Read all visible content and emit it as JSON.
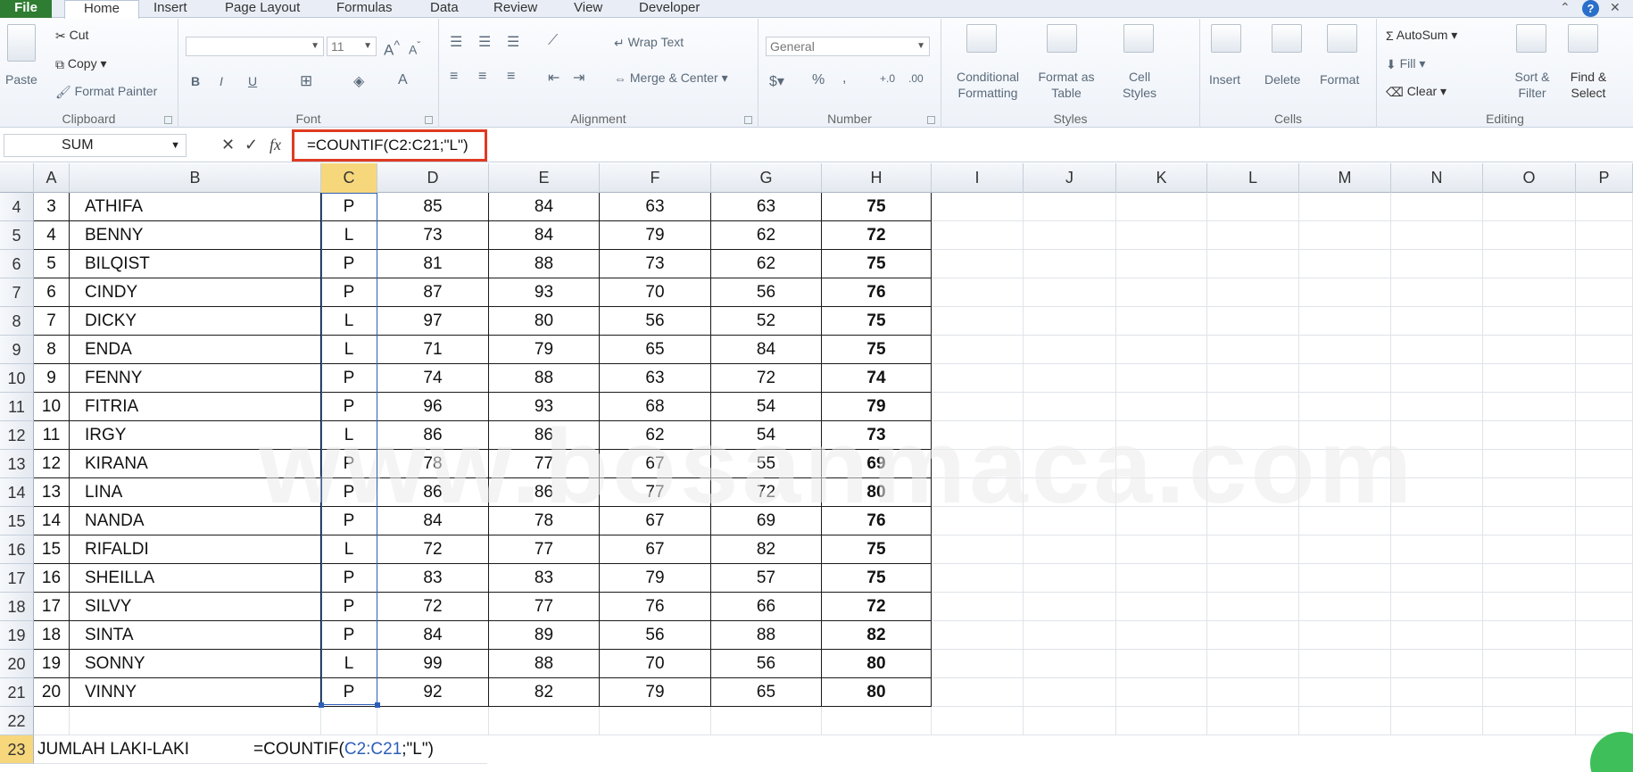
{
  "ribbon_tabs": [
    "File",
    "Home",
    "Insert",
    "Page Layout",
    "Formulas",
    "Data",
    "Review",
    "View",
    "Developer"
  ],
  "clipboard": {
    "paste": "Paste",
    "cut": "Cut",
    "copy": "Copy",
    "format_painter": "Format Painter",
    "label": "Clipboard"
  },
  "font": {
    "name": "",
    "size": "11",
    "label": "Font",
    "bold": "B",
    "italic": "I",
    "underline": "U"
  },
  "alignment": {
    "wrap_text": "Wrap Text",
    "merge_center": "Merge & Center",
    "label": "Alignment"
  },
  "number": {
    "format": "General",
    "percent": "%",
    "comma": ",",
    "label": "Number"
  },
  "styles": {
    "conditional": "Conditional Formatting",
    "format_table": "Format as Table",
    "cell_styles": "Cell Styles",
    "label": "Styles"
  },
  "cells": {
    "insert": "Insert",
    "delete": "Delete",
    "format": "Format",
    "label": "Cells"
  },
  "editing": {
    "autosum": "AutoSum",
    "fill": "Fill",
    "clear": "Clear",
    "sort": "Sort & Filter",
    "find": "Find & Select",
    "label": "Editing"
  },
  "formula_bar": {
    "name_box": "SUM",
    "cancel": "✕",
    "enter": "✓",
    "fx": "fx",
    "formula": "=COUNTIF(C2:C21;\"L\")"
  },
  "columns": [
    "A",
    "B",
    "C",
    "D",
    "E",
    "F",
    "G",
    "H",
    "I",
    "J",
    "K",
    "L",
    "M",
    "N",
    "O",
    "P"
  ],
  "rows": [
    {
      "r": "4",
      "no": "3",
      "name": "ATHIFA",
      "g": "P",
      "d": "85",
      "e": "84",
      "f": "63",
      "gv": "63",
      "h": "75"
    },
    {
      "r": "5",
      "no": "4",
      "name": "BENNY",
      "g": "L",
      "d": "73",
      "e": "84",
      "f": "79",
      "gv": "62",
      "h": "72"
    },
    {
      "r": "6",
      "no": "5",
      "name": "BILQIST",
      "g": "P",
      "d": "81",
      "e": "88",
      "f": "73",
      "gv": "62",
      "h": "75"
    },
    {
      "r": "7",
      "no": "6",
      "name": "CINDY",
      "g": "P",
      "d": "87",
      "e": "93",
      "f": "70",
      "gv": "56",
      "h": "76"
    },
    {
      "r": "8",
      "no": "7",
      "name": "DICKY",
      "g": "L",
      "d": "97",
      "e": "80",
      "f": "56",
      "gv": "52",
      "h": "75"
    },
    {
      "r": "9",
      "no": "8",
      "name": "ENDA",
      "g": "L",
      "d": "71",
      "e": "79",
      "f": "65",
      "gv": "84",
      "h": "75"
    },
    {
      "r": "10",
      "no": "9",
      "name": "FENNY",
      "g": "P",
      "d": "74",
      "e": "88",
      "f": "63",
      "gv": "72",
      "h": "74"
    },
    {
      "r": "11",
      "no": "10",
      "name": "FITRIA",
      "g": "P",
      "d": "96",
      "e": "93",
      "f": "68",
      "gv": "54",
      "h": "79"
    },
    {
      "r": "12",
      "no": "11",
      "name": "IRGY",
      "g": "L",
      "d": "86",
      "e": "86",
      "f": "62",
      "gv": "54",
      "h": "73"
    },
    {
      "r": "13",
      "no": "12",
      "name": "KIRANA",
      "g": "P",
      "d": "78",
      "e": "77",
      "f": "67",
      "gv": "55",
      "h": "69"
    },
    {
      "r": "14",
      "no": "13",
      "name": "LINA",
      "g": "P",
      "d": "86",
      "e": "86",
      "f": "77",
      "gv": "72",
      "h": "80"
    },
    {
      "r": "15",
      "no": "14",
      "name": "NANDA",
      "g": "P",
      "d": "84",
      "e": "78",
      "f": "67",
      "gv": "69",
      "h": "76"
    },
    {
      "r": "16",
      "no": "15",
      "name": "RIFALDI",
      "g": "L",
      "d": "72",
      "e": "77",
      "f": "67",
      "gv": "82",
      "h": "75"
    },
    {
      "r": "17",
      "no": "16",
      "name": "SHEILLA",
      "g": "P",
      "d": "83",
      "e": "83",
      "f": "79",
      "gv": "57",
      "h": "75"
    },
    {
      "r": "18",
      "no": "17",
      "name": "SILVY",
      "g": "P",
      "d": "72",
      "e": "77",
      "f": "76",
      "gv": "66",
      "h": "72"
    },
    {
      "r": "19",
      "no": "18",
      "name": "SINTA",
      "g": "P",
      "d": "84",
      "e": "89",
      "f": "56",
      "gv": "88",
      "h": "82"
    },
    {
      "r": "20",
      "no": "19",
      "name": "SONNY",
      "g": "L",
      "d": "99",
      "e": "88",
      "f": "70",
      "gv": "56",
      "h": "80"
    },
    {
      "r": "21",
      "no": "20",
      "name": "VINNY",
      "g": "P",
      "d": "92",
      "e": "82",
      "f": "79",
      "gv": "65",
      "h": "80"
    }
  ],
  "row22": "22",
  "row23": {
    "r": "23",
    "label": "JUMLAH LAKI-LAKI",
    "prefix": "=COUNTIF(",
    "ref": "C2:C21",
    "suffix": ";\"L\")"
  },
  "watermark": "www.bosanmaca.com"
}
